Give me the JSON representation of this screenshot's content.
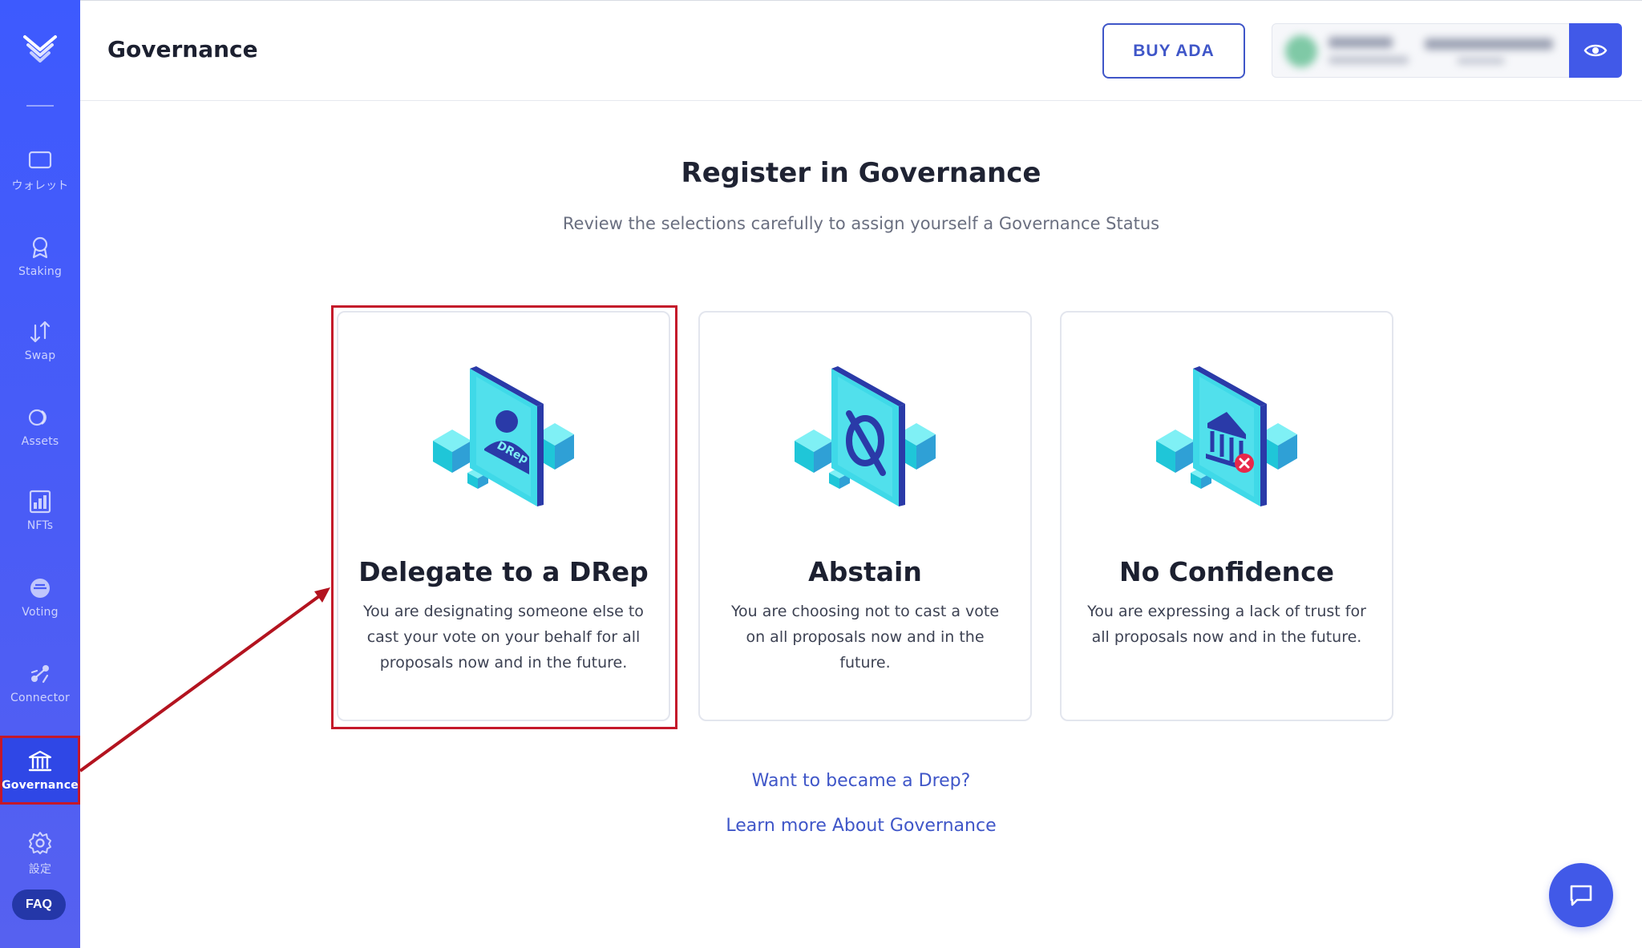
{
  "sidebar": {
    "items": [
      {
        "label": "ウォレット",
        "icon": "wallet-icon"
      },
      {
        "label": "Staking",
        "icon": "staking-icon"
      },
      {
        "label": "Swap",
        "icon": "swap-icon"
      },
      {
        "label": "Assets",
        "icon": "assets-icon"
      },
      {
        "label": "NFTs",
        "icon": "nfts-icon"
      },
      {
        "label": "Voting",
        "icon": "voting-icon"
      },
      {
        "label": "Connector",
        "icon": "connector-icon"
      },
      {
        "label": "Governance",
        "icon": "governance-icon",
        "active": true
      },
      {
        "label": "設定",
        "icon": "gear-icon"
      }
    ],
    "faq_label": "FAQ"
  },
  "header": {
    "title": "Governance",
    "buy_label": "BUY ADA"
  },
  "main": {
    "title": "Register in Governance",
    "subtitle": "Review the selections carefully to assign yourself a Governance Status",
    "cards": [
      {
        "title": "Delegate to a DRep",
        "desc": "You are designating someone else to cast your vote on your behalf for all proposals now and in the future.",
        "badge": "DRep",
        "selected": true
      },
      {
        "title": "Abstain",
        "desc": "You are choosing not to cast a vote on all proposals now and in the future."
      },
      {
        "title": "No Confidence",
        "desc": "You are expressing a lack of trust for all proposals now and in the future."
      }
    ],
    "links": {
      "become_drep": "Want to became a Drep?",
      "learn_more": "Learn more About Governance"
    }
  },
  "colors": {
    "sidebar": "#3d5afe",
    "accent": "#3f56c8",
    "highlight": "#c4182a",
    "illustration_cyan": "#39d3e3",
    "illustration_navy": "#2a3aa8"
  }
}
